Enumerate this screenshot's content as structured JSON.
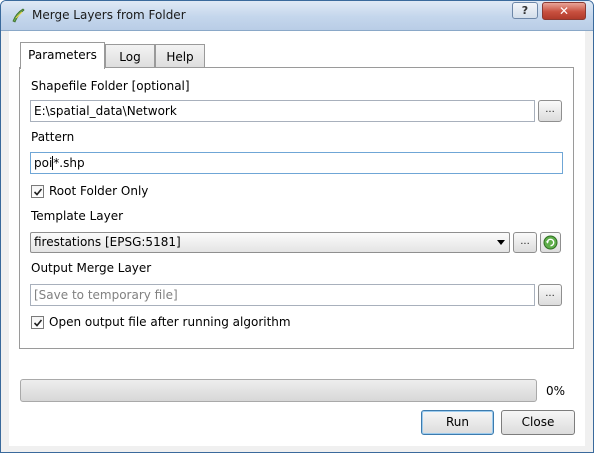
{
  "window": {
    "title": "Merge Layers from Folder",
    "help_button": "?",
    "close_button": "✕"
  },
  "tabs": [
    {
      "label": "Parameters",
      "active": true
    },
    {
      "label": "Log",
      "active": false
    },
    {
      "label": "Help",
      "active": false
    }
  ],
  "params": {
    "folder_label": "Shapefile Folder [optional]",
    "folder_value": "E:\\spatial_data\\Network",
    "folder_browse": "...",
    "pattern_label": "Pattern",
    "pattern_before_caret": "poi",
    "pattern_after_caret": "*.shp",
    "root_only_label": "Root Folder Only",
    "root_only_checked": true,
    "template_label": "Template Layer",
    "template_value": "firestations [EPSG:5181]",
    "template_browse": "...",
    "output_label": "Output Merge Layer",
    "output_placeholder": "[Save to temporary file]",
    "output_browse": "...",
    "open_output_label": "Open output file after running algorithm",
    "open_output_checked": true
  },
  "progress": {
    "value": 0,
    "text": "0%"
  },
  "buttons": {
    "run": "Run",
    "close": "Close"
  },
  "colors": {
    "accent": "#3d7bad",
    "close_red": "#c8503f",
    "progress_green": "#3c9a3c"
  }
}
